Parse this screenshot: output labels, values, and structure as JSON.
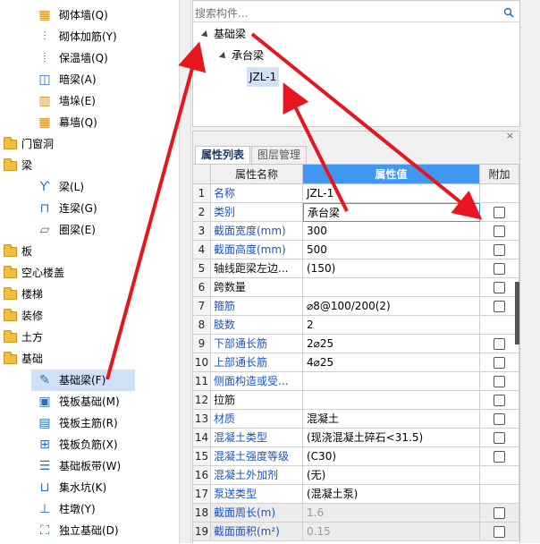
{
  "left_tree": {
    "items": [
      {
        "label": "砌体墙(Q)",
        "icon": "masonry-wall-icon",
        "level": 2
      },
      {
        "label": "砌体加筋(Y)",
        "icon": "masonry-rebar-icon",
        "level": 2
      },
      {
        "label": "保温墙(Q)",
        "icon": "insulation-wall-icon",
        "level": 2
      },
      {
        "label": "暗梁(A)",
        "icon": "hidden-beam-icon",
        "level": 2
      },
      {
        "label": "墙垛(E)",
        "icon": "wall-pier-icon",
        "level": 2
      },
      {
        "label": "幕墙(Q)",
        "icon": "curtain-wall-icon",
        "level": 2
      },
      {
        "label": "门窗洞",
        "icon": "folder-icon",
        "level": 1
      },
      {
        "label": "梁",
        "icon": "folder-open-icon",
        "level": 1
      },
      {
        "label": "梁(L)",
        "icon": "beam-icon",
        "level": 2
      },
      {
        "label": "连梁(G)",
        "icon": "coupling-beam-icon",
        "level": 2
      },
      {
        "label": "圈梁(E)",
        "icon": "ring-beam-icon",
        "level": 2
      },
      {
        "label": "板",
        "icon": "folder-icon",
        "level": 1
      },
      {
        "label": "空心楼盖",
        "icon": "folder-icon",
        "level": 1
      },
      {
        "label": "楼梯",
        "icon": "folder-icon",
        "level": 1
      },
      {
        "label": "装修",
        "icon": "folder-icon",
        "level": 1
      },
      {
        "label": "土方",
        "icon": "folder-icon",
        "level": 1
      },
      {
        "label": "基础",
        "icon": "folder-open-icon",
        "level": 1
      },
      {
        "label": "基础梁(F)",
        "icon": "foundation-beam-icon",
        "level": 2,
        "selected": true
      },
      {
        "label": "筏板基础(M)",
        "icon": "raft-foundation-icon",
        "level": 2
      },
      {
        "label": "筏板主筋(R)",
        "icon": "raft-main-rebar-icon",
        "level": 2
      },
      {
        "label": "筏板负筋(X)",
        "icon": "raft-negative-rebar-icon",
        "level": 2
      },
      {
        "label": "基础板带(W)",
        "icon": "foundation-strip-icon",
        "level": 2
      },
      {
        "label": "集水坑(K)",
        "icon": "sump-pit-icon",
        "level": 2
      },
      {
        "label": "柱墩(Y)",
        "icon": "column-pier-icon",
        "level": 2
      },
      {
        "label": "独立基础(D)",
        "icon": "isolated-footing-icon",
        "level": 2
      }
    ]
  },
  "component_tree": {
    "search_placeholder": "搜索构件...",
    "root": "基础梁",
    "child": "承台梁",
    "leaf": "JZL-1"
  },
  "properties": {
    "tabs": [
      "属性列表",
      "图层管理"
    ],
    "headers": {
      "name": "属性名称",
      "value": "属性值",
      "extra": "附加"
    },
    "rows": [
      {
        "num": "1",
        "name": "名称",
        "value": "JZL-1",
        "blue": true,
        "checkbox": false
      },
      {
        "num": "2",
        "name": "类别",
        "value": "承台梁",
        "blue": true,
        "checkbox": true,
        "editing": true
      },
      {
        "num": "3",
        "name": "截面宽度(mm)",
        "value": "300",
        "blue": true,
        "checkbox": true
      },
      {
        "num": "4",
        "name": "截面高度(mm)",
        "value": "500",
        "blue": true,
        "checkbox": true
      },
      {
        "num": "5",
        "name": "轴线距梁左边...",
        "value": "(150)",
        "blue": false,
        "checkbox": true
      },
      {
        "num": "6",
        "name": "跨数量",
        "value": "",
        "blue": false,
        "checkbox": true
      },
      {
        "num": "7",
        "name": "箍筋",
        "value": "⌀8@100/200(2)",
        "blue": true,
        "checkbox": true
      },
      {
        "num": "8",
        "name": "肢数",
        "value": "2",
        "blue": true,
        "checkbox": false
      },
      {
        "num": "9",
        "name": "下部通长筋",
        "value": "2⌀25",
        "blue": true,
        "checkbox": true
      },
      {
        "num": "10",
        "name": "上部通长筋",
        "value": "4⌀25",
        "blue": true,
        "checkbox": true
      },
      {
        "num": "11",
        "name": "侧面构造或受...",
        "value": "",
        "blue": true,
        "checkbox": true
      },
      {
        "num": "12",
        "name": "拉筋",
        "value": "",
        "blue": false,
        "checkbox": true
      },
      {
        "num": "13",
        "name": "材质",
        "value": "混凝土",
        "blue": true,
        "checkbox": true
      },
      {
        "num": "14",
        "name": "混凝土类型",
        "value": "(现浇混凝土碎石<31.5)",
        "blue": true,
        "checkbox": true
      },
      {
        "num": "15",
        "name": "混凝土强度等级",
        "value": "(C30)",
        "blue": true,
        "checkbox": true
      },
      {
        "num": "16",
        "name": "混凝土外加剂",
        "value": "(无)",
        "blue": true,
        "checkbox": false
      },
      {
        "num": "17",
        "name": "泵送类型",
        "value": "(混凝土泵)",
        "blue": true,
        "checkbox": false
      },
      {
        "num": "18",
        "name": "截面周长(m)",
        "value": "1.6",
        "blue": true,
        "checkbox": true,
        "greyed": true
      },
      {
        "num": "19",
        "name": "截面面积(m²)",
        "value": "0.15",
        "blue": true,
        "checkbox": true,
        "greyed": true
      }
    ]
  },
  "colors": {
    "arrow": "#e8141e",
    "selected_row": "#cfe0f7",
    "header_value": "#3f97f2",
    "link_blue": "#1a55c0"
  }
}
